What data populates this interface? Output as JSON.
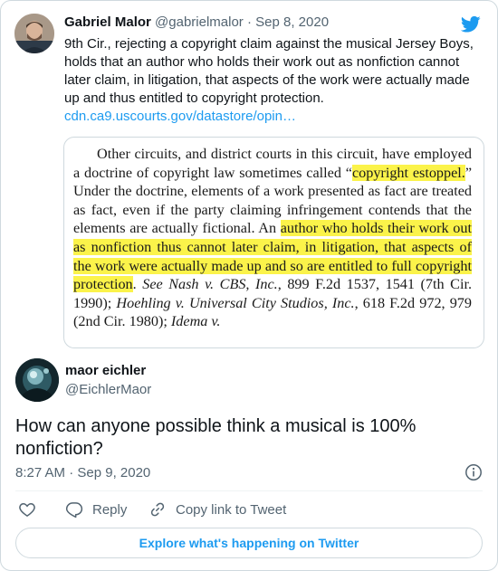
{
  "quoted_tweet": {
    "author_name": "Gabriel Malor",
    "handle": "@gabrielmalor",
    "separator": "·",
    "date": "Sep 8, 2020",
    "text": "9th Cir., rejecting a copyright claim against the musical Jersey Boys, holds that an author who holds their work out as nonfiction cannot later claim, in litigation, that aspects of the work were actually made up and thus entitled to copyright protection.",
    "link": "cdn.ca9.uscourts.gov/datastore/opin…",
    "document_excerpt": {
      "s1": "Other circuits, and district courts in this circuit, have employed a doctrine of copyright law sometimes called “",
      "h1": "copyright estoppel.",
      "s2": "” Under the doctrine, elements of a work presented as fact are treated as fact, even if the party claiming infringement contends that the elements are actually fictional. An ",
      "h2": "author who holds their work out as nonfiction thus cannot later claim, in litigation, that aspects of the work were actually made up and so are entitled to full copyright protection",
      "s3": ". ",
      "i1": "See Nash v. CBS, Inc.",
      "s4": ", 899 F.2d 1537, 1541 (7th Cir. 1990); ",
      "i2": "Hoehling v. Universal City Studios, Inc.",
      "s5": ", 618 F.2d 972, 979 (2nd Cir. 1980); ",
      "i3": "Idema v."
    }
  },
  "reply_tweet": {
    "author_name": "maor eichler",
    "handle": "@EichlerMaor",
    "text": "How can anyone possible think a musical is 100% nonfiction?",
    "timestamp": "8:27 AM · Sep 9, 2020"
  },
  "actions": {
    "reply_label": "Reply",
    "copy_label": "Copy link to Tweet"
  },
  "footer": {
    "explore_label": "Explore what's happening on Twitter"
  },
  "icons": [
    "twitter-bird-icon",
    "heart-icon",
    "reply-icon",
    "link-icon",
    "info-icon"
  ],
  "colors": {
    "accent": "#1d9bf0",
    "secondary_text": "#536471",
    "highlight": "#fbf34a",
    "border": "#cfd9de"
  }
}
